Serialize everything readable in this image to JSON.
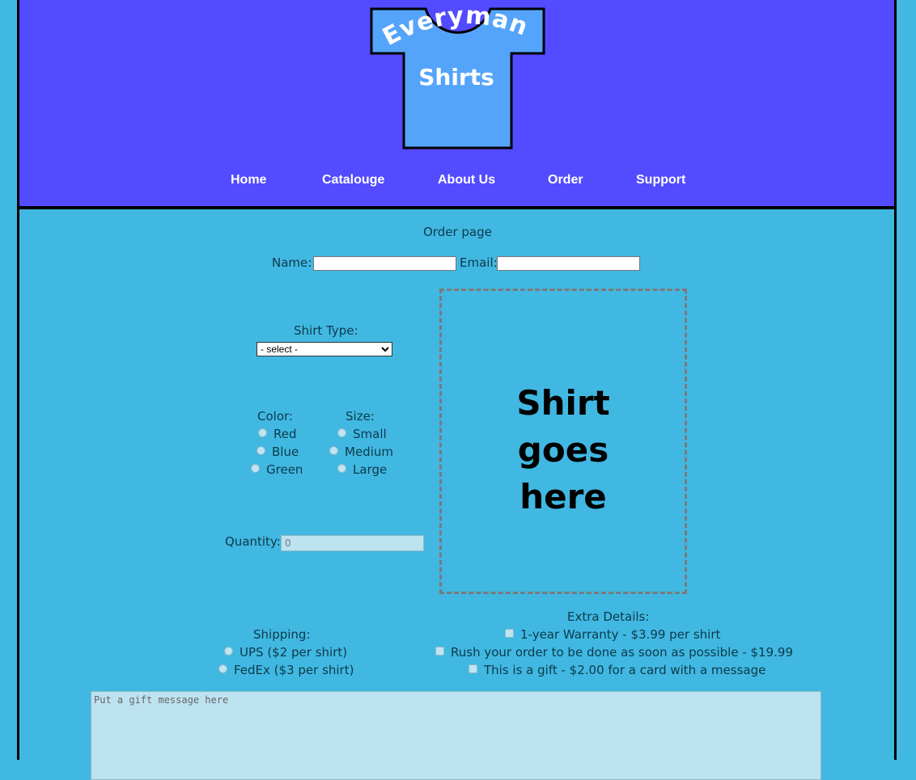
{
  "logo": {
    "line1": "Everyman",
    "line2": "Shirts"
  },
  "nav": {
    "home": "Home",
    "catalogue": "Catalouge",
    "about": "About Us",
    "order": "Order",
    "support": "Support"
  },
  "page_title": "Order page",
  "form": {
    "name_label": "Name:",
    "email_label": "Email:",
    "shirt_type_label": "Shirt Type:",
    "shirt_type_selected": "- select -",
    "color_label": "Color:",
    "colors": [
      "Red",
      "Blue",
      "Green"
    ],
    "size_label": "Size:",
    "sizes": [
      "Small",
      "Medium",
      "Large"
    ],
    "quantity_label": "Quantity:",
    "quantity_placeholder": "0",
    "shipping_label": "Shipping:",
    "shipping_options": [
      "UPS ($2 per shirt)",
      "FedEx ($3 per shirt)"
    ],
    "extras_label": "Extra Details:",
    "extras": [
      "1-year Warranty - $3.99 per shirt",
      "Rush your order to be done as soon as possible - $19.99",
      "This is a gift - $2.00 for a card with a message"
    ],
    "gift_placeholder": "Put a gift message here"
  },
  "preview_text": "Shirt\ngoes\nhere",
  "colors_theme": {
    "header": "#534bff",
    "body": "#41b8e2",
    "shirt": "#55a4fb"
  }
}
